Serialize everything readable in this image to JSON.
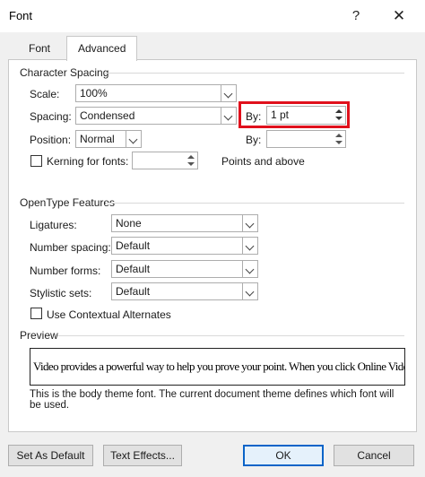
{
  "window": {
    "title": "Font",
    "help": "?",
    "close": "✕"
  },
  "tabs": [
    {
      "label": "Font",
      "active": false
    },
    {
      "label": "Advanced",
      "active": true
    }
  ],
  "character_spacing": {
    "group_label": "Character Spacing",
    "scale": {
      "label": "Scale:",
      "value": "100%"
    },
    "spacing": {
      "label": "Spacing:",
      "value": "Condensed"
    },
    "spacing_by": {
      "label": "By:",
      "value": "1 pt"
    },
    "position": {
      "label": "Position:",
      "value": "Normal"
    },
    "position_by": {
      "label": "By:",
      "value": ""
    },
    "kerning": {
      "label": "Kerning for fonts:",
      "checked": false,
      "value": ""
    },
    "points_label": "Points and above"
  },
  "opentype": {
    "group_label": "OpenType Features",
    "ligatures": {
      "label": "Ligatures:",
      "value": "None"
    },
    "number_spacing": {
      "label": "Number spacing:",
      "value": "Default"
    },
    "number_forms": {
      "label": "Number forms:",
      "value": "Default"
    },
    "stylistic_sets": {
      "label": "Stylistic sets:",
      "value": "Default"
    },
    "contextual": {
      "label": "Use Contextual Alternates",
      "checked": false
    }
  },
  "preview": {
    "group_label": "Preview",
    "text": "Video provides a powerful way to help you prove your point. When you click Online Video, you ca",
    "note": "This is the body theme font. The current document theme defines which font will be used."
  },
  "buttons": {
    "set_default": "Set As Default",
    "text_effects": "Text Effects...",
    "ok": "OK",
    "cancel": "Cancel"
  },
  "colors": {
    "highlight": "#e0101c",
    "ok_border": "#0a64c8"
  }
}
